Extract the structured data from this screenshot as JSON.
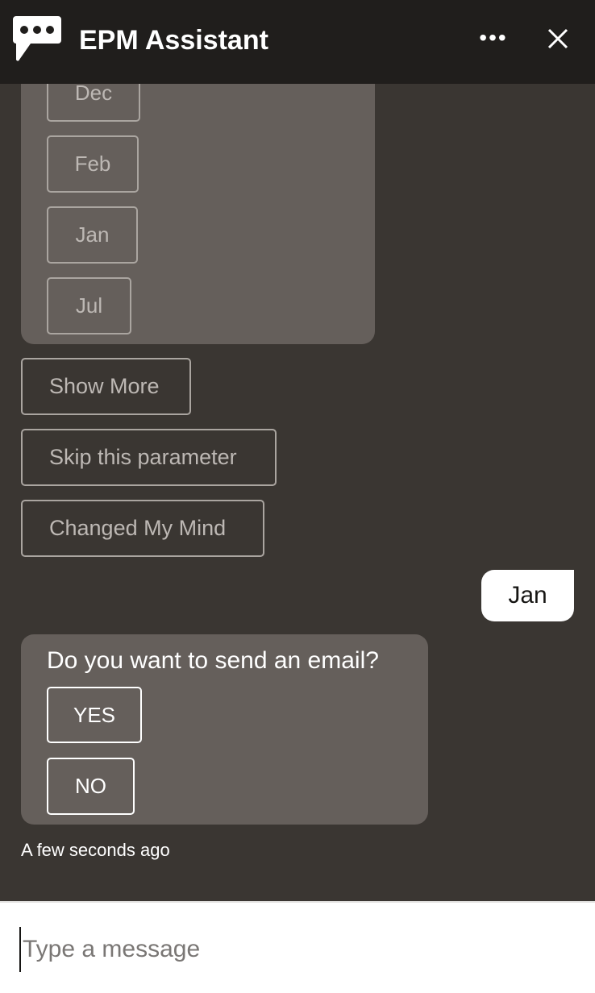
{
  "header": {
    "title": "EPM Assistant",
    "logo_icon": "chat-bubble-icon",
    "more_icon": "more-horizontal-icon",
    "close_icon": "close-icon",
    "more_label": "•••"
  },
  "options_card": {
    "options": [
      "Dec",
      "Feb",
      "Jan",
      "Jul"
    ]
  },
  "actions": [
    "Show More",
    "Skip this parameter",
    "Changed My Mind"
  ],
  "user_message": "Jan",
  "email_card": {
    "question": "Do you want to send an email?",
    "options": [
      "YES",
      "NO"
    ]
  },
  "timestamp": "A few seconds ago",
  "composer": {
    "placeholder": "Type a message",
    "value": ""
  },
  "colors": {
    "header_bg": "#201e1c",
    "chat_bg": "#3a3632",
    "bot_bubble": "#655f5b",
    "user_bubble": "#ffffff"
  }
}
